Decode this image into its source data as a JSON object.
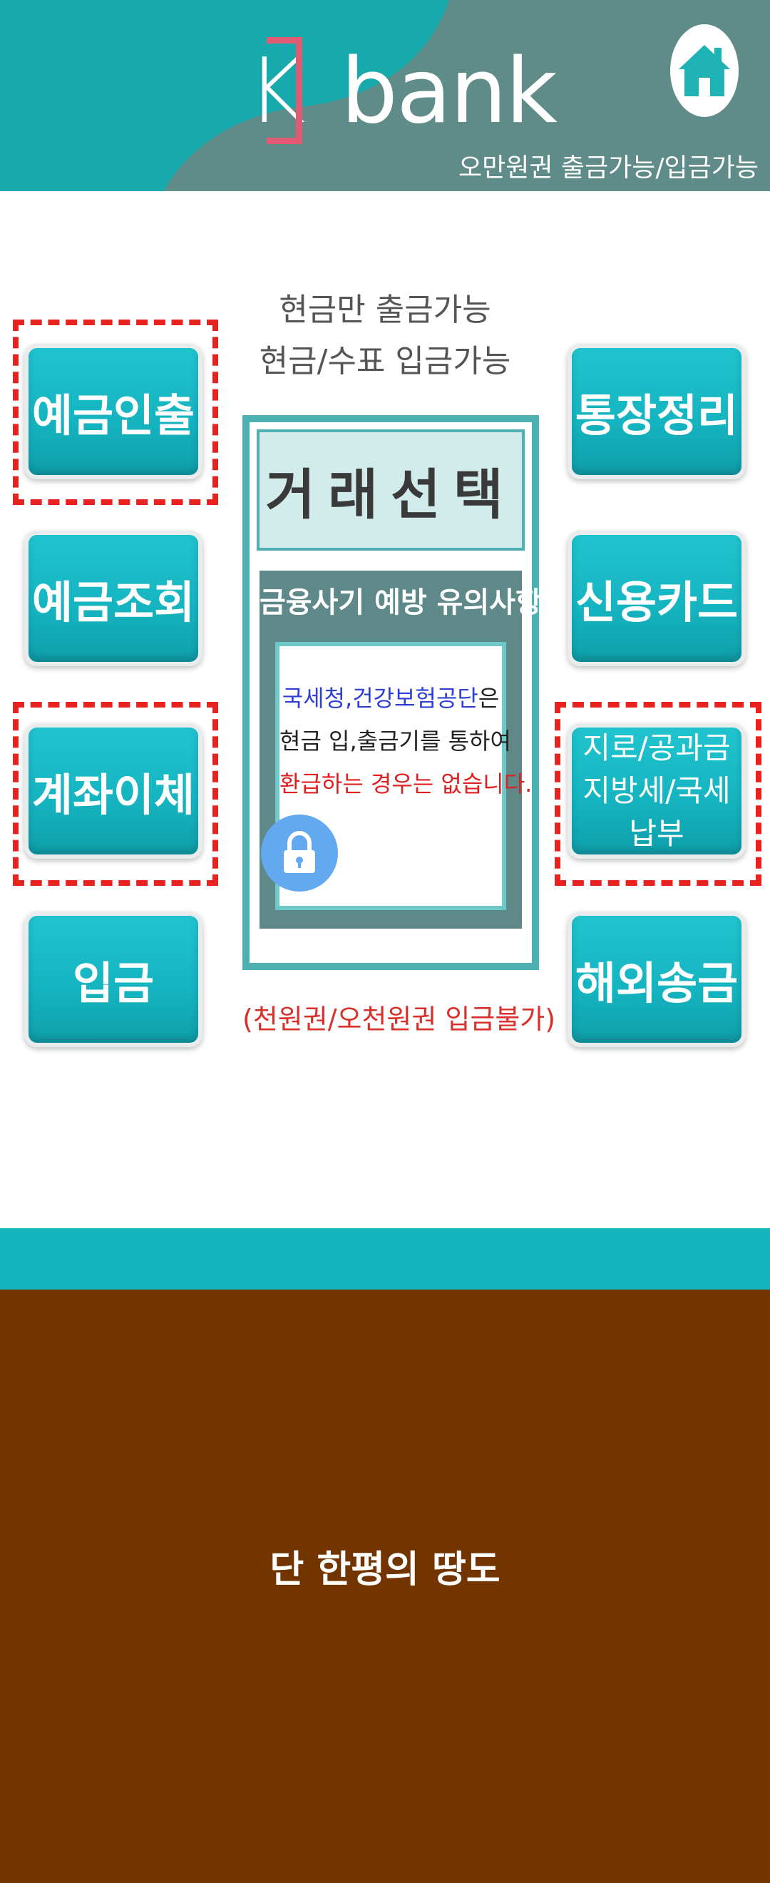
{
  "header": {
    "logo_k": "K",
    "logo_bank": "bank",
    "status": "오만원권 출금가능/입금가능",
    "home_icon": "home-icon",
    "colors": {
      "background": "#5f8c89",
      "wave": "#18a9ad",
      "logo_bracket": "#e25a73"
    }
  },
  "notice": {
    "line1": "현금만 출금가능",
    "line2": "현금/수표 입금가능"
  },
  "left_buttons": [
    {
      "label": "예금인출",
      "highlighted": true
    },
    {
      "label": "예금조회",
      "highlighted": false
    },
    {
      "label": "계좌이체",
      "highlighted": true
    },
    {
      "label": "입금",
      "highlighted": false
    }
  ],
  "right_buttons": [
    {
      "label": "통장정리",
      "highlighted": false
    },
    {
      "label": "신용카드",
      "highlighted": false
    },
    {
      "line1": "지로/공과금",
      "line2": "지방세/국세 납부",
      "highlighted": true
    },
    {
      "label": "해외송금",
      "highlighted": false
    }
  ],
  "panel": {
    "title": "거래선택",
    "warning_title": "금융사기 예방 유의사항",
    "warning_lines": {
      "line1_blue": "국세청,건강보험공단",
      "line1_rest": "은",
      "line2": "현금 입,출금기를 통하여",
      "line3": "환급하는 경우는 없습니다."
    },
    "lock_icon": "lock-icon"
  },
  "bottom_notice": "(천원권/오천원권 입금불가)",
  "ad": {
    "text": "단 한평의 땅도"
  },
  "colors": {
    "button": "#16b4bf",
    "highlight": "#e8231f",
    "ad_background": "#733500",
    "band": "#16b4bd"
  }
}
